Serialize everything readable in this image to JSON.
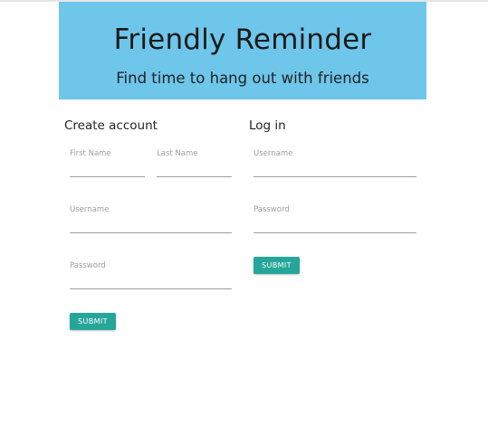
{
  "header": {
    "title": "Friendly Reminder",
    "subtitle": "Find time to hang out with friends"
  },
  "create_account": {
    "title": "Create account",
    "first_name_label": "First Name",
    "last_name_label": "Last Name",
    "username_label": "Username",
    "password_label": "Password",
    "submit_label": "SUBMIT"
  },
  "login": {
    "title": "Log in",
    "username_label": "Username",
    "password_label": "Password",
    "submit_label": "SUBMIT"
  },
  "colors": {
    "header_bg": "#6ec6ea",
    "button_bg": "#26a69a"
  }
}
